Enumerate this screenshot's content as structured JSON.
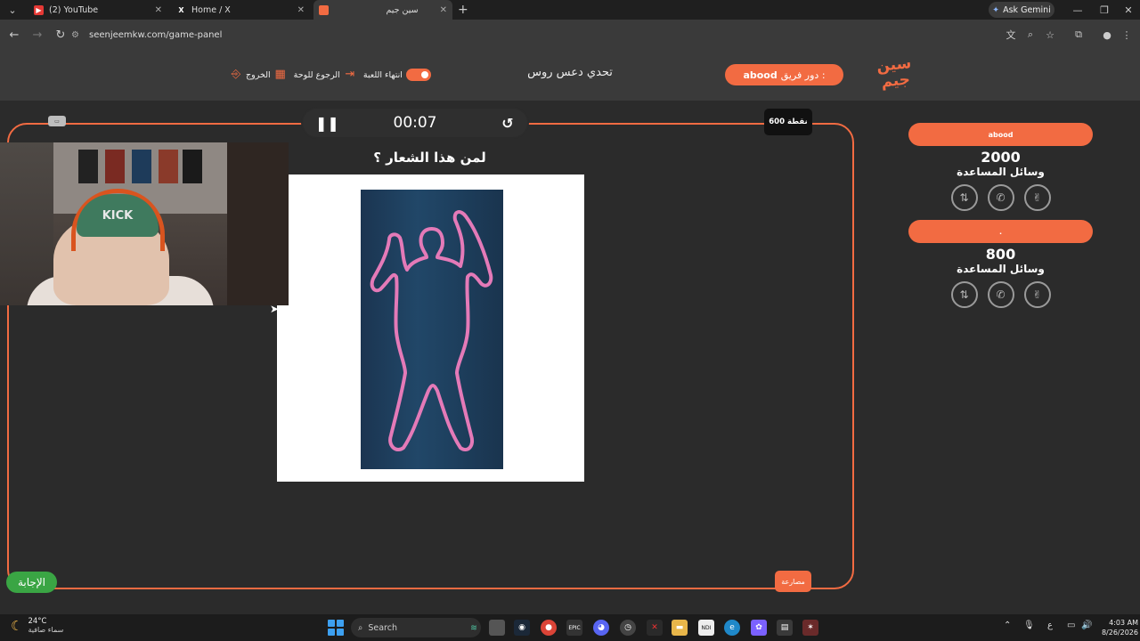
{
  "browser": {
    "tabs": [
      {
        "title": "(2) YouTube",
        "favicon": "youtube-icon",
        "active": false
      },
      {
        "title": "Home / X",
        "favicon": "x-icon",
        "active": false
      },
      {
        "title": "سين جيم",
        "favicon": "seenjeem-icon",
        "active": true
      }
    ],
    "gemini_label": "Ask Gemini",
    "url": "seenjeemkw.com/game-panel"
  },
  "header": {
    "logo_text": "سين جيم",
    "team_turn_prefix": "دور فريق :",
    "team_turn_name": "abood",
    "challenge_title": "تحدي دعس روس",
    "actions": {
      "end_game": "انتهاء اللعبة",
      "back_to_board": "الرجوع للوحة",
      "exit": "الخروج"
    }
  },
  "game": {
    "timer": "00:07",
    "points_badge": "600 نقطة",
    "question": "لمن هذا الشعار ؟",
    "answer_button": "الإجابة",
    "report_button": "مصارعة",
    "webcam_cap_text": "KICK",
    "image_alt": "Pink body-outline silhouette on a navy towel"
  },
  "scoreboard": {
    "aids_label": "وسائل المساعدة",
    "teams": [
      {
        "name": "abood",
        "score": "2000"
      },
      {
        "name": ".",
        "score": "800"
      }
    ],
    "aid_icons": [
      "call-split-icon",
      "phone-icon",
      "hand-icon"
    ]
  },
  "taskbar": {
    "temperature": "24°C",
    "weather": "سماء صافية",
    "search_placeholder": "Search",
    "language": "ع",
    "time": "4:03 AM",
    "date": "8/26/2026"
  },
  "colors": {
    "accent": "#f26b42",
    "answer_green": "#3aa544",
    "background": "#2b2b2b"
  }
}
